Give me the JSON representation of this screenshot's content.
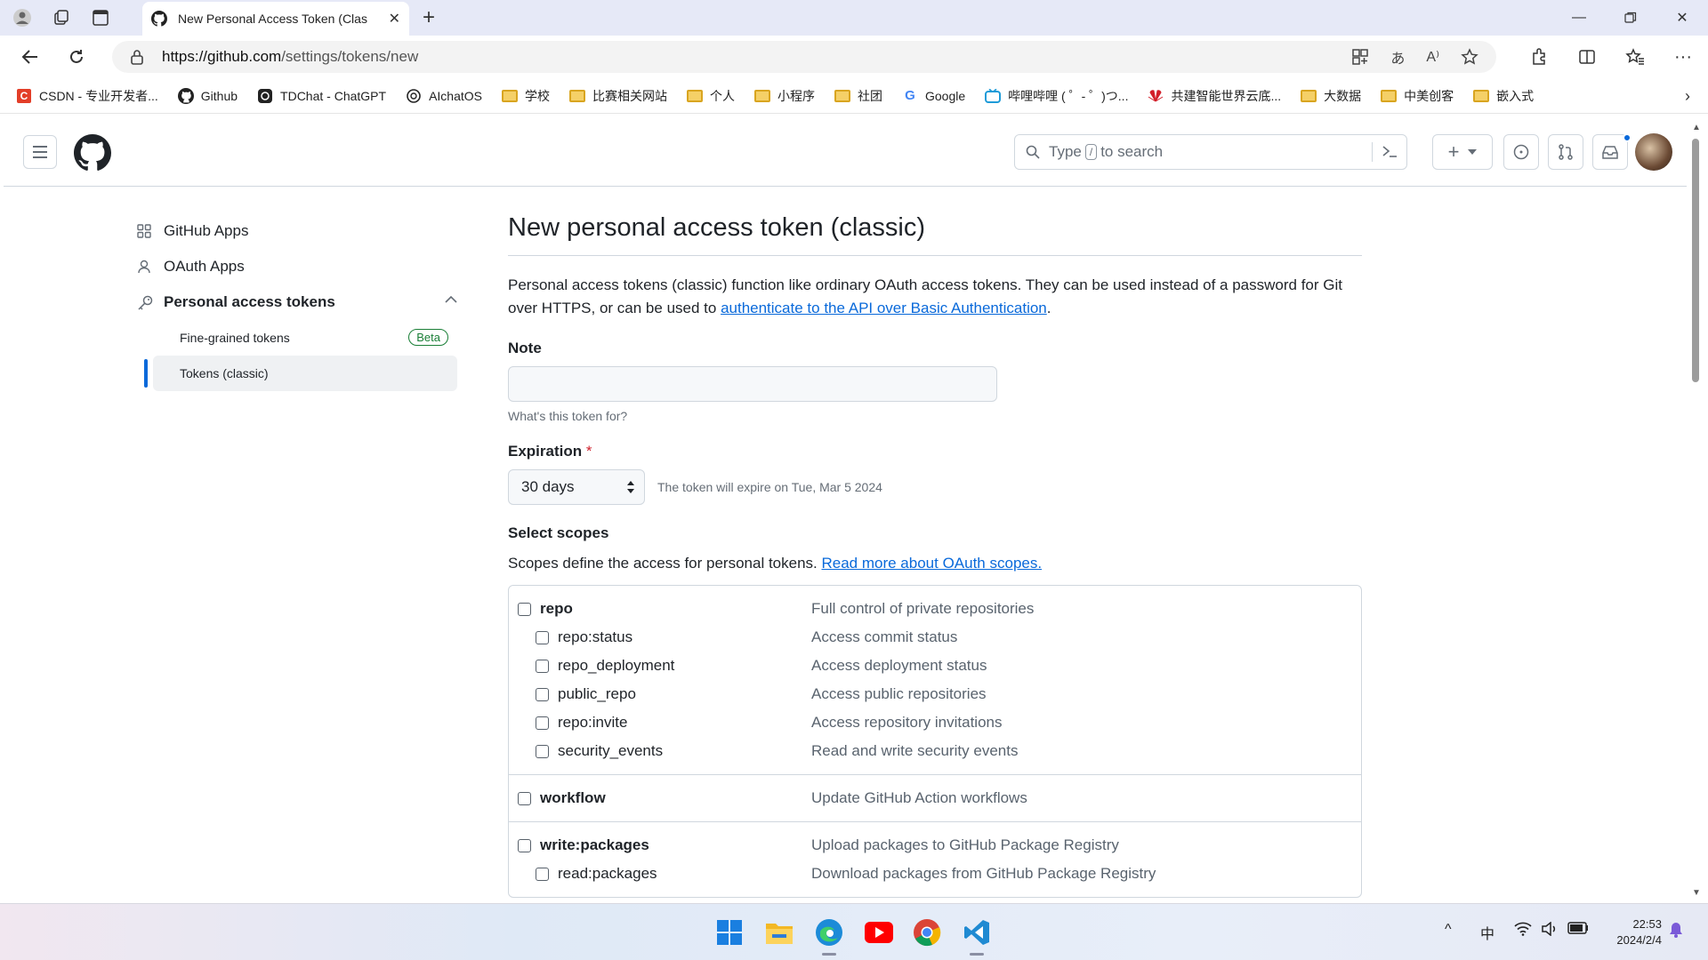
{
  "browser": {
    "tab_title": "New Personal Access Token (Clas",
    "url_host": "https://github.com",
    "url_path": "/settings/tokens/new",
    "bookmarks": [
      {
        "label": "CSDN - 专业开发者...",
        "icon": "csdn-icon"
      },
      {
        "label": "Github",
        "icon": "github-icon"
      },
      {
        "label": "TDChat - ChatGPT",
        "icon": "openai-icon"
      },
      {
        "label": "AIchatOS",
        "icon": "openai-icon"
      },
      {
        "label": "学校",
        "icon": "folder-icon"
      },
      {
        "label": "比赛相关网站",
        "icon": "folder-icon"
      },
      {
        "label": "个人",
        "icon": "folder-icon"
      },
      {
        "label": "小程序",
        "icon": "folder-icon"
      },
      {
        "label": "社团",
        "icon": "folder-icon"
      },
      {
        "label": "Google",
        "icon": "google-icon"
      },
      {
        "label": "哔哩哔哩 ( ゜- ゜)つ...",
        "icon": "bilibili-icon"
      },
      {
        "label": "共建智能世界云底...",
        "icon": "huawei-icon"
      },
      {
        "label": "大数据",
        "icon": "folder-icon"
      },
      {
        "label": "中美创客",
        "icon": "folder-icon"
      },
      {
        "label": "嵌入式",
        "icon": "folder-icon"
      }
    ]
  },
  "header": {
    "search_prefix": "Type",
    "search_key": "/",
    "search_suffix": "to search",
    "plus_label": "+"
  },
  "sidebar": {
    "items": [
      {
        "label": "GitHub Apps",
        "icon": "apps-grid-icon"
      },
      {
        "label": "OAuth Apps",
        "icon": "person-icon"
      },
      {
        "label": "Personal access tokens",
        "icon": "key-icon"
      }
    ],
    "sub_items": [
      {
        "label": "Fine-grained tokens",
        "badge": "Beta"
      },
      {
        "label": "Tokens (classic)"
      }
    ]
  },
  "main": {
    "title": "New personal access token (classic)",
    "description": "Personal access tokens (classic) function like ordinary OAuth access tokens. They can be used instead of a password for Git over HTTPS, or can be used to ",
    "description_link": "authenticate to the API over Basic Authentication",
    "description_end": ".",
    "note_label": "Note",
    "note_value": "",
    "note_hint": "What's this token for?",
    "expiration_label": "Expiration",
    "expiration_required": "*",
    "expiration_value": "30 days",
    "expiration_note": "The token will expire on Tue, Mar 5 2024",
    "scopes_label": "Select scopes",
    "scopes_desc": "Scopes define the access for personal tokens. ",
    "scopes_link": "Read more about OAuth scopes.",
    "scope_groups": [
      {
        "name": "repo",
        "desc": "Full control of private repositories",
        "children": [
          {
            "name": "repo:status",
            "desc": "Access commit status"
          },
          {
            "name": "repo_deployment",
            "desc": "Access deployment status"
          },
          {
            "name": "public_repo",
            "desc": "Access public repositories"
          },
          {
            "name": "repo:invite",
            "desc": "Access repository invitations"
          },
          {
            "name": "security_events",
            "desc": "Read and write security events"
          }
        ]
      },
      {
        "name": "workflow",
        "desc": "Update GitHub Action workflows",
        "children": []
      },
      {
        "name": "write:packages",
        "desc": "Upload packages to GitHub Package Registry",
        "children": [
          {
            "name": "read:packages",
            "desc": "Download packages from GitHub Package Registry"
          }
        ]
      }
    ]
  },
  "taskbar": {
    "ime": "中",
    "time": "22:53",
    "date": "2024/2/4"
  },
  "colors": {
    "accent": "#0969da",
    "success": "#1a7f37",
    "danger": "#cf222e"
  }
}
